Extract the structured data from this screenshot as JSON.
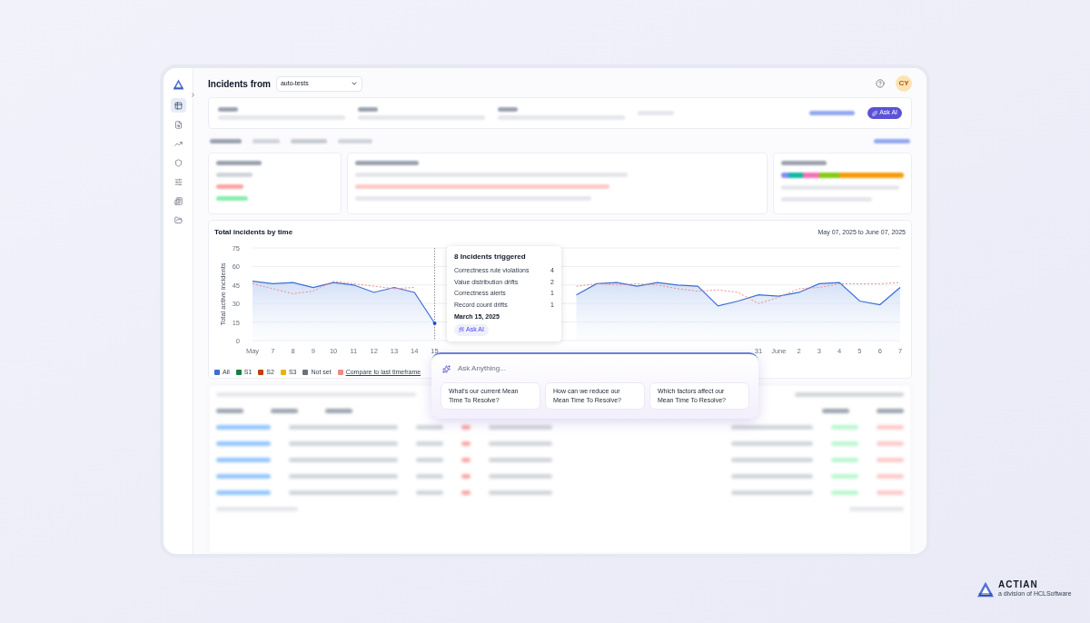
{
  "sidebar": {
    "items": [
      {
        "selected": true
      },
      {
        "selected": false
      },
      {
        "selected": false
      },
      {
        "selected": false
      },
      {
        "selected": false
      },
      {
        "selected": false
      },
      {
        "selected": false
      }
    ]
  },
  "header": {
    "title": "Incidents from",
    "source_select": "auto-tests",
    "avatar": "CY"
  },
  "filters": {
    "ask_ai_button": "Ask AI"
  },
  "chart_card": {
    "title": "Total incidents by time",
    "date_range": "May 07, 2025 to June 07, 2025",
    "chart_data": {
      "type": "area",
      "grid": true,
      "ylabel": "Total active incidents",
      "categories": [
        "May",
        "7",
        "8",
        "9",
        "10",
        "11",
        "12",
        "13",
        "14",
        "15",
        null,
        null,
        null,
        null,
        null,
        null,
        null,
        null,
        null,
        null,
        null,
        null,
        null,
        null,
        null,
        "31",
        "June",
        "2",
        "3",
        "4",
        "5",
        "6",
        "7"
      ],
      "yticks": [
        0,
        15,
        30,
        45,
        60,
        75
      ],
      "ref_lines": [
        {
          "axis": "x",
          "value": "15",
          "color": "#6b7280",
          "line_style": "dotted"
        }
      ],
      "ylim": [
        0,
        75
      ],
      "series": [
        {
          "name": "All",
          "color": "#3b6fd4",
          "type": "area",
          "line_style": "solid",
          "values": [
            48,
            46,
            47,
            43,
            47,
            45,
            39,
            43,
            39,
            14,
            null,
            null,
            null,
            null,
            null,
            null,
            37,
            46,
            47,
            44,
            47,
            45,
            44,
            28,
            32,
            37,
            36,
            39,
            46,
            47,
            32,
            29,
            43
          ]
        },
        {
          "name": "Compare to last timeframe",
          "color": "#f08a8a",
          "type": "line",
          "line_style": "dashed",
          "values": [
            46,
            42,
            38,
            40,
            48,
            46,
            44,
            42,
            43,
            null,
            null,
            null,
            null,
            null,
            null,
            null,
            44,
            46,
            45,
            46,
            45,
            42,
            40,
            41,
            39,
            30,
            35,
            42,
            43,
            46,
            46,
            46,
            47
          ]
        }
      ]
    },
    "legend": [
      {
        "label": "S1",
        "color": "#15803d"
      },
      {
        "label": "S2",
        "color": "#c2410c"
      },
      {
        "label": "S3",
        "color": "#eab308"
      },
      {
        "label": "Not set",
        "color": "#6b7280"
      }
    ],
    "tooltip": {
      "title": "8 Incidents triggered",
      "rows": [
        {
          "label": "Correctness rule violations",
          "count": "4"
        },
        {
          "label": "Value distribution drifts",
          "count": "2"
        },
        {
          "label": "Correctness alerts",
          "count": "1"
        },
        {
          "label": "Record count drifts",
          "count": "1"
        }
      ],
      "date": "March 15, 2025",
      "ask_ai_button": "Ask AI"
    }
  },
  "ai_prompt": {
    "placeholder": "Ask Anything...",
    "suggestions": [
      "What's our current Mean Time To Resolve?",
      "How can we reduce our Mean Time To Resolve?",
      "Which factors affect our Mean Time To Resolve?"
    ]
  },
  "brand": {
    "name": "ACTIAN",
    "tagline": "a division of HCLSoftware"
  }
}
